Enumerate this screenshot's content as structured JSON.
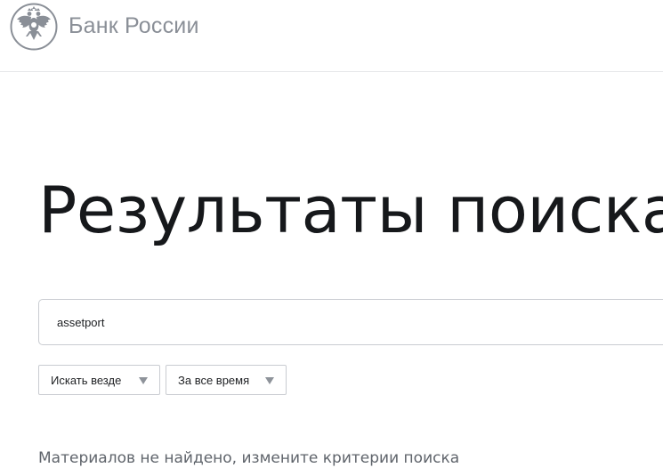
{
  "header": {
    "logo_text": "Банк России",
    "emblem_icon": "double-headed-eagle-emblem"
  },
  "main": {
    "title": "Результаты поиска",
    "search": {
      "value": "assetport",
      "placeholder": ""
    },
    "filters": [
      {
        "label": "Искать везде",
        "icon": "caret-down-icon"
      },
      {
        "label": "За все время",
        "icon": "caret-down-icon"
      }
    ],
    "empty_message": "Материалов не найдено, измените критерии поиска"
  },
  "colors": {
    "logo_gray": "#8a8f97",
    "title": "#16181b",
    "border": "#c9ccd1",
    "muted_text": "#5f646b",
    "caret": "#8e939a"
  }
}
